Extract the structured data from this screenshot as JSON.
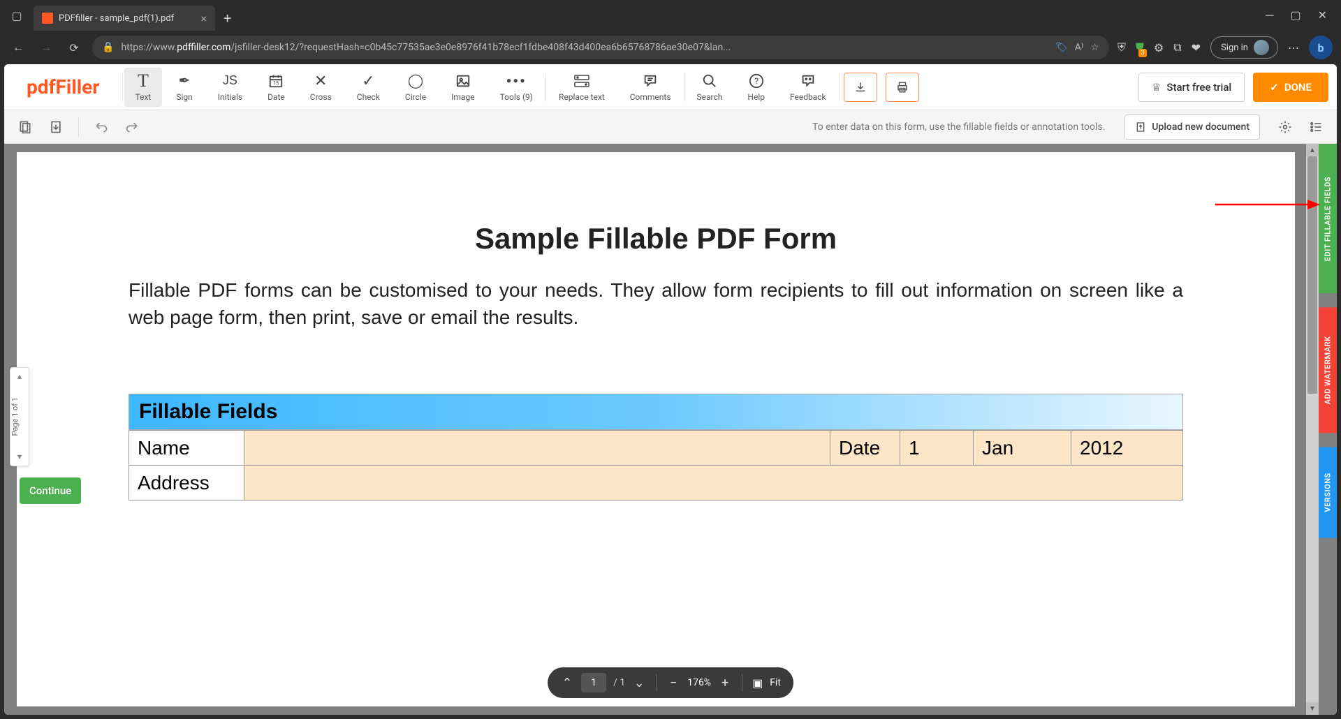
{
  "browser": {
    "tab_title": "PDFfiller - sample_pdf(1).pdf",
    "url_display_prefix": "https://www.",
    "url_display_host": "pdffiller.com",
    "url_display_path": "/jsfiller-desk12/?requestHash=c0b45c77535ae3e0e8976f41b78ecf1fdbe408f43d400ea6b65768786ae30e07&lan...",
    "signin_label": "Sign in"
  },
  "app": {
    "logo": "pdfFiller",
    "tools": [
      {
        "label": "Text",
        "icon": "T"
      },
      {
        "label": "Sign",
        "icon": "✒"
      },
      {
        "label": "Initials",
        "icon": "JS"
      },
      {
        "label": "Date",
        "icon": "📅"
      },
      {
        "label": "Cross",
        "icon": "✕"
      },
      {
        "label": "Check",
        "icon": "✓"
      },
      {
        "label": "Circle",
        "icon": "◯"
      },
      {
        "label": "Image",
        "icon": "🖼"
      },
      {
        "label": "Tools (9)",
        "icon": "⋯"
      }
    ],
    "tools2": [
      {
        "label": "Replace text",
        "icon": "⇄"
      },
      {
        "label": "Comments",
        "icon": "💬"
      }
    ],
    "tools3": [
      {
        "label": "Search",
        "icon": "🔍"
      },
      {
        "label": "Help",
        "icon": "?"
      },
      {
        "label": "Feedback",
        "icon": "💭"
      }
    ],
    "trial_label": "Start free trial",
    "done_label": "DONE",
    "hint": "To enter data on this form, use the fillable fields or annotation tools.",
    "upload_label": "Upload new document"
  },
  "document": {
    "title": "Sample Fillable PDF Form",
    "paragraph": "Fillable PDF forms can be customised to your needs. They allow form recipients to fill out information on screen like a web page form, then print, save or email the results.",
    "section_header": "Fillable Fields",
    "form": {
      "name_label": "Name",
      "date_label": "Date",
      "date_day": "1",
      "date_month": "Jan",
      "date_year": "2012",
      "address_label": "Address"
    }
  },
  "side_tabs": {
    "edit": "EDIT FILLABLE FIELDS",
    "watermark": "ADD WATERMARK",
    "versions": "VERSIONS"
  },
  "page_nav": {
    "label": "Page 1 of 1",
    "continue": "Continue"
  },
  "zoom": {
    "page_current": "1",
    "page_total": "/ 1",
    "zoom_pct": "176%",
    "fit_label": "Fit"
  }
}
